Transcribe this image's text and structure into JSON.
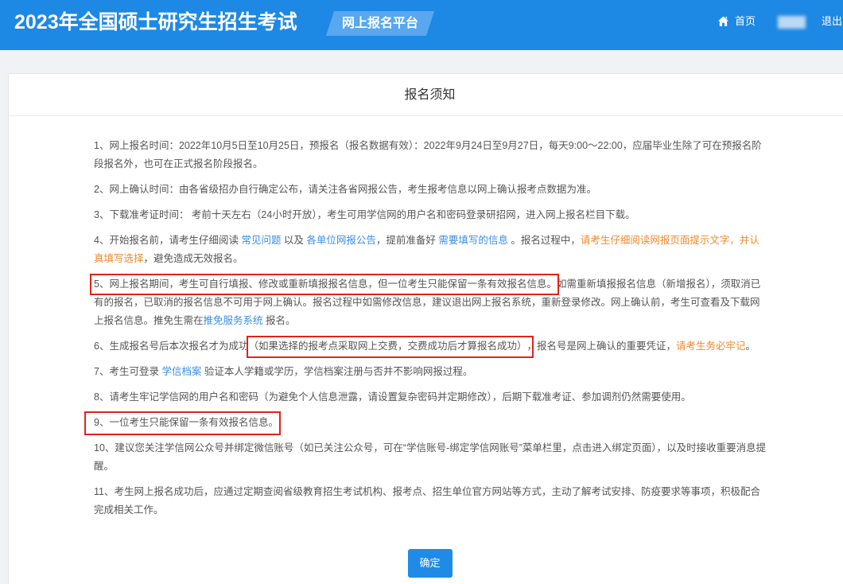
{
  "header": {
    "title": "2023年全国硕士研究生招生考试",
    "badge": "网上报名平台",
    "home_icon": "home-icon",
    "home_label": "首页",
    "logout_label": "退出"
  },
  "notice": {
    "title": "报名须知",
    "items": [
      [
        "1、网上报名时间：2022年10月5日至10月25日，预报名（报名数据有效）：2022年9月24日至9月27日，每天9:00～22:00，应届毕业生除了可在预报名阶段报名外，也可在正式报名阶段报名。"
      ],
      [
        "2、网上确认时间：由各省级招办自行确定公布，请关注各省网报公告，考生报考信息以网上确认报考点数据为准。"
      ],
      [
        "3、下载准考证时间： 考前十天左右（24小时开放），考生可用学信网的用户名和密码登录研招网，进入网上报名栏目下载。"
      ],
      [
        "4、开始报名前，请考生仔细阅读 ",
        "常见问题",
        " 以及 ",
        "各单位网报公告",
        "，提前准备好 ",
        "需要填写的信息",
        " 。报名过程中，",
        "请考生仔细阅读网报页面提示文字，并认真填写选择",
        "，避免造成无效报名。"
      ],
      [
        "5、网上报名期间，考生可自行填报、修改或重新填报报名信息，但一位考生只能保留一条有效报名信息。",
        "如需重新填报报名信息（新增报名），须取消已有的报名，已取消的报名信息不可用于网上确认。报名过程中如需修改信息，建议退出网上报名系统，重新登录修改。网上确认前，考生可查看及下载网上报名信息。推免生需在",
        "推免服务系统",
        " 报名。"
      ],
      [
        "6、生成报名号后本次报名才为成功",
        "（如果选择的报考点采取网上交费，交费成功后才算报名成功）",
        "，报名号是网上确认的重要凭证，",
        "请考生务必牢记",
        "。"
      ],
      [
        "7、考生可登录 ",
        "学信档案",
        " 验证本人学籍或学历，学信档案注册与否并不影响网报过程。"
      ],
      [
        "8、请考生牢记学信网的用户名和密码（为避免个人信息泄露，请设置复杂密码并定期修改），后期下载准考证、参加调剂仍然需要使用。"
      ],
      [
        "9、一位考生只能保留一条有效报名信息。"
      ],
      [
        "10、建议您关注学信网公众号并绑定微信账号（如已关注公众号，可在“学信账号-绑定学信网账号”菜单栏里，点击进入绑定页面），以及时接收重要消息提醒。"
      ],
      [
        "11、考生网上报名成功后，应通过定期查阅省级教育招生考试机构、报考点、招生单位官方网站等方式，主动了解考试安排、防疫要求等事项，积极配合完成相关工作。"
      ]
    ],
    "confirm_label": "确定"
  },
  "colors": {
    "header_bg": "#1e88e5",
    "badge_bg": "#58a7ef",
    "text": "#555555",
    "link": "#3a8ee6",
    "highlight": "#f0892a",
    "annotation": "#e2231a",
    "button_bg": "#1f8be6"
  }
}
